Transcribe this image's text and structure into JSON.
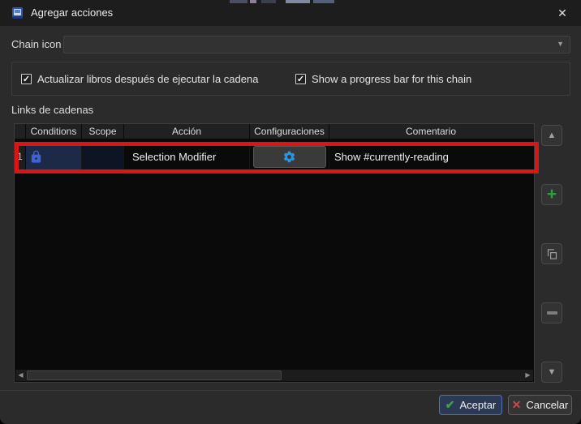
{
  "window": {
    "title": "Agregar acciones",
    "close_glyph": "✕"
  },
  "chain_icon": {
    "label": "Chain icon",
    "value": "",
    "dropdown_glyph": "▼"
  },
  "options": {
    "update_books_label": "Actualizar libros después de ejecutar la cadena",
    "update_books_checked": "✓",
    "progress_bar_label": "Show a progress bar for this chain",
    "progress_bar_checked": "✓"
  },
  "links_section": {
    "label": "Links de cadenas"
  },
  "table": {
    "columns": [
      "Conditions",
      "Scope",
      "Acción",
      "Configuraciones",
      "Comentario"
    ],
    "rows": [
      {
        "num": "1",
        "conditions_icon": "lock-icon",
        "scope": "",
        "accion": "Selection Modifier",
        "configuraciones_icon": "gear-icon",
        "comentario": "Show #currently-reading"
      }
    ]
  },
  "scrollbar": {
    "left_glyph": "◀",
    "right_glyph": "▶"
  },
  "side_buttons": {
    "move_up_glyph": "▲",
    "add_glyph": "+",
    "copy_icon": "copy-icon",
    "remove_glyph": "−",
    "move_down_glyph": "▼"
  },
  "footer": {
    "accept_label": "Aceptar",
    "accept_glyph": "✔",
    "cancel_label": "Cancelar",
    "cancel_glyph": "✕"
  },
  "colors": {
    "dialog_bg": "#2b2b2b",
    "titlebar_bg": "#1d1d1d",
    "table_bg": "#0a0a0a",
    "selected_cell_bg": "#1c2a47",
    "lock_blue": "#3f63d6",
    "gear_blue": "#1e9bf0",
    "add_green": "#2f9e3f",
    "accept_check_green": "#43a047",
    "cancel_x_red": "#d64545",
    "accept_border_blue": "#4f74b3",
    "annotation_red": "#d91616"
  }
}
